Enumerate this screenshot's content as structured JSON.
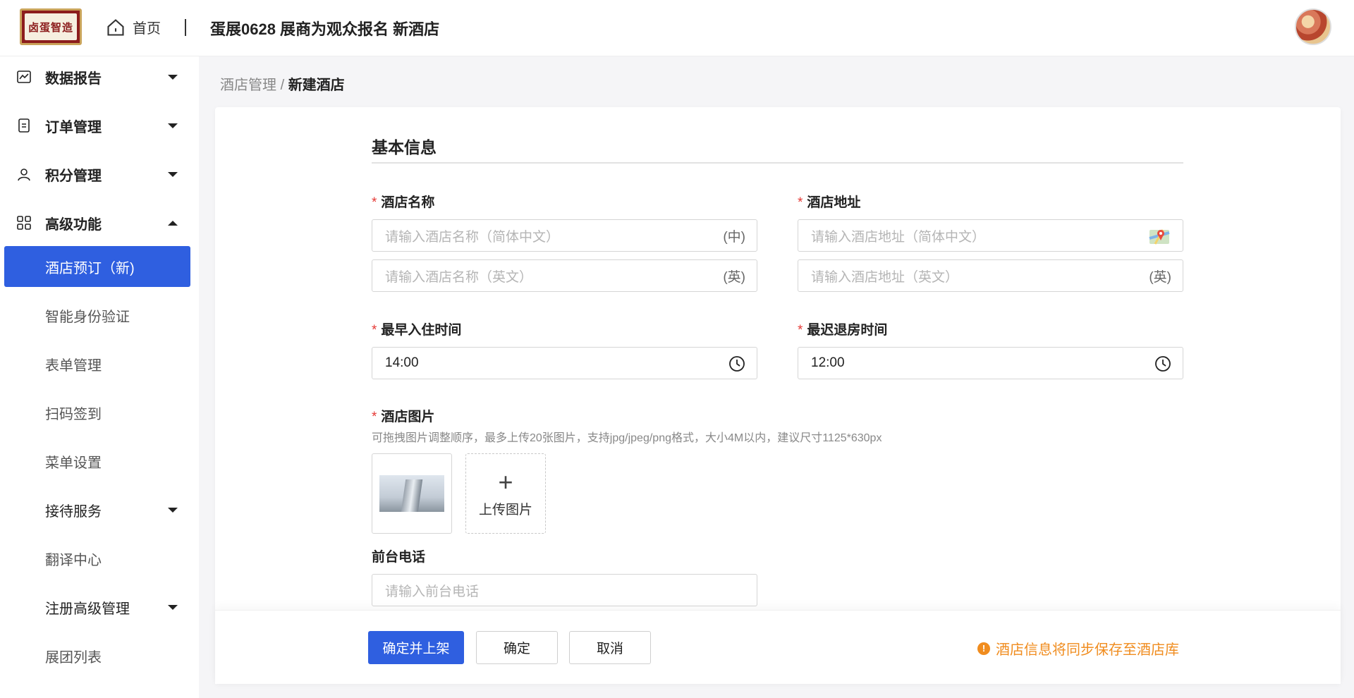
{
  "header": {
    "logo_text": "卤蛋智造",
    "home_label": "首页",
    "title": "蛋展0628 展商为观众报名 新酒店"
  },
  "sidebar": {
    "items": [
      {
        "label": "数据报告",
        "icon": "chart-icon",
        "kind": "group",
        "caret": "down"
      },
      {
        "label": "订单管理",
        "icon": "document-icon",
        "kind": "group",
        "caret": "down"
      },
      {
        "label": "积分管理",
        "icon": "user-icon",
        "kind": "group",
        "caret": "down"
      },
      {
        "label": "高级功能",
        "icon": "grid-icon",
        "kind": "group",
        "caret": "up"
      },
      {
        "label": "酒店预订（新)",
        "kind": "sub",
        "active": true
      },
      {
        "label": "智能身份验证",
        "kind": "sub"
      },
      {
        "label": "表单管理",
        "kind": "sub"
      },
      {
        "label": "扫码签到",
        "kind": "sub"
      },
      {
        "label": "菜单设置",
        "kind": "sub"
      },
      {
        "label": "接待服务",
        "kind": "sub",
        "caret": "down"
      },
      {
        "label": "翻译中心",
        "kind": "sub"
      },
      {
        "label": "注册高级管理",
        "kind": "sub",
        "caret": "down"
      },
      {
        "label": "展团列表",
        "kind": "sub"
      }
    ]
  },
  "breadcrumb": {
    "parent": "酒店管理",
    "separator": "/",
    "current": "新建酒店"
  },
  "form": {
    "section_title": "基本信息",
    "required_mark": "*",
    "hotel_name": {
      "label": "酒店名称",
      "zh_placeholder": "请输入酒店名称（简体中文）",
      "zh_suffix": "(中)",
      "en_placeholder": "请输入酒店名称（英文）",
      "en_suffix": "(英)"
    },
    "hotel_address": {
      "label": "酒店地址",
      "zh_placeholder": "请输入酒店地址（简体中文）",
      "en_placeholder": "请输入酒店地址（英文）",
      "en_suffix": "(英)"
    },
    "checkin": {
      "label": "最早入住时间",
      "value": "14:00"
    },
    "checkout": {
      "label": "最迟退房时间",
      "value": "12:00"
    },
    "images": {
      "label": "酒店图片",
      "hint": "可拖拽图片调整顺序，最多上传20张图片，支持jpg/jpeg/png格式，大小4M以内，建议尺寸1125*630px",
      "upload_label": "上传图片",
      "upload_symbol": "+"
    },
    "phone": {
      "label": "前台电话",
      "placeholder": "请输入前台电话"
    }
  },
  "footer": {
    "confirm_publish": "确定并上架",
    "confirm": "确定",
    "cancel": "取消",
    "notice_mark": "!",
    "notice": "酒店信息将同步保存至酒店库"
  },
  "colors": {
    "primary": "#2f5fe0",
    "required": "#e53935",
    "warning": "#f08c1e"
  }
}
